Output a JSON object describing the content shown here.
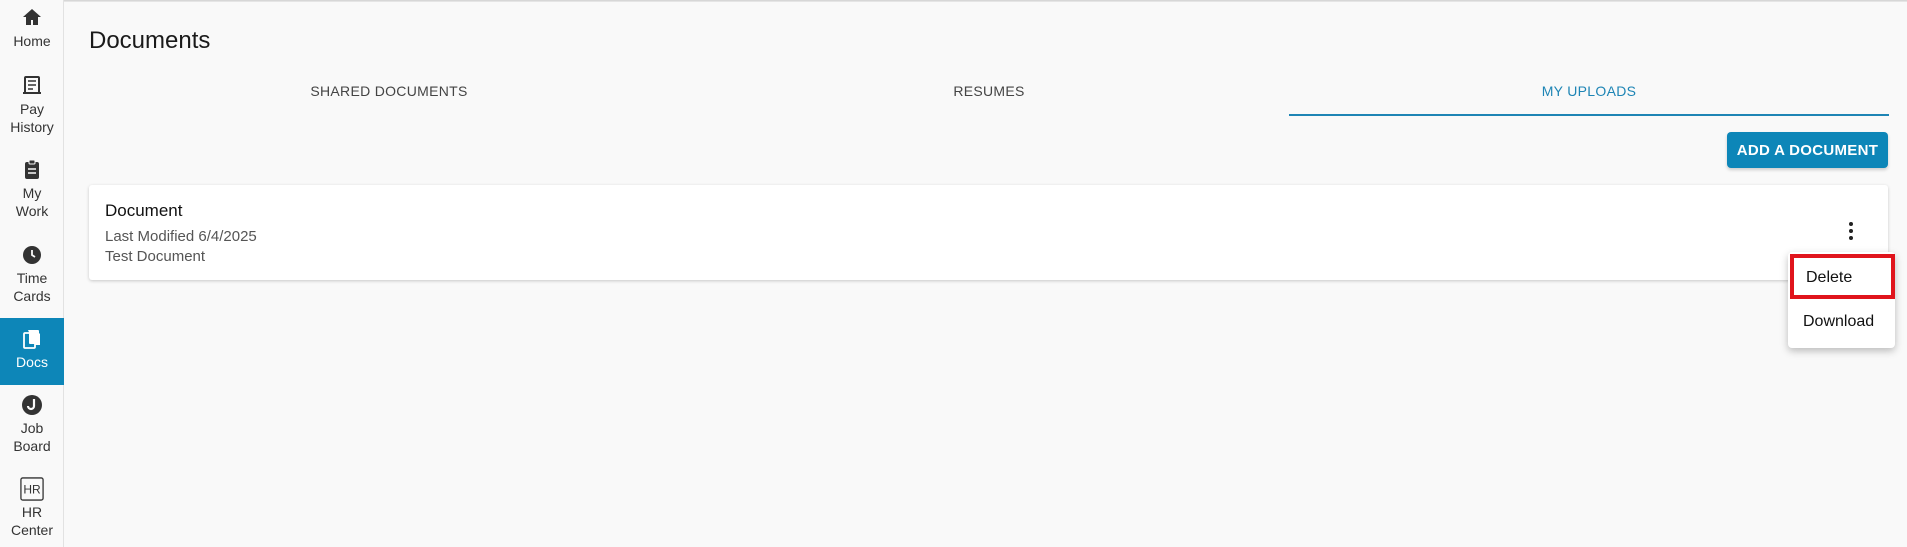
{
  "sidebar": {
    "items": [
      {
        "label": "Home",
        "icon": "home-icon"
      },
      {
        "label": "Pay\nHistory",
        "icon": "receipt-icon"
      },
      {
        "label": "My\nWork",
        "icon": "clipboard-icon"
      },
      {
        "label": "Time\nCards",
        "icon": "clock-icon"
      },
      {
        "label": "Docs",
        "icon": "documents-icon",
        "active": true
      },
      {
        "label": "Job\nBoard",
        "icon": "job-board-icon"
      },
      {
        "label": "HR\nCenter",
        "icon": "hr-icon"
      }
    ]
  },
  "page": {
    "title": "Documents"
  },
  "tabs": [
    {
      "label": "SHARED DOCUMENTS"
    },
    {
      "label": "RESUMES"
    },
    {
      "label": "MY UPLOADS",
      "active": true
    }
  ],
  "toolbar": {
    "add_label": "ADD A DOCUMENT"
  },
  "document": {
    "title": "Document",
    "modified": "Last Modified 6/4/2025",
    "description": "Test Document"
  },
  "menu": {
    "items": [
      {
        "label": "Delete"
      },
      {
        "label": "Download"
      }
    ]
  },
  "colors": {
    "accent": "#0d86b8",
    "tab_active": "#1e85b5",
    "highlight_border": "#e0141c"
  }
}
